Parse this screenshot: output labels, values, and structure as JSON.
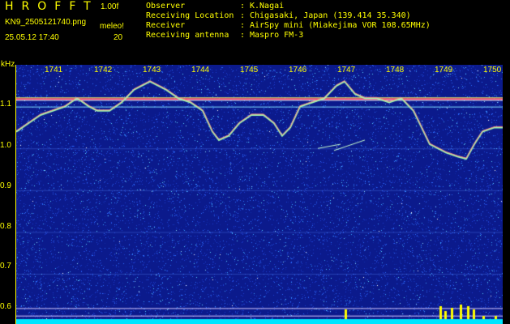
{
  "header": {
    "app_title": "HROFFT",
    "version": "1.00f",
    "filename": "KN9_2505121740.png",
    "timestamp": "25.05.12 17:40",
    "meleo_label": "meleo!",
    "meleo_value": "20"
  },
  "info": [
    {
      "key": "Observer",
      "value": "K.Nagai"
    },
    {
      "key": "Receiving Location",
      "value": "Chigasaki, Japan (139.414 35.340)"
    },
    {
      "key": "Receiver",
      "value": "AirSpy mini (Miakejima VOR 108.65MHz)"
    },
    {
      "key": "Receiving antenna",
      "value": "Maspro FM-3"
    }
  ],
  "spectrogram": {
    "y_unit": "kHz",
    "y_ticks": [
      "1.1",
      "1.0",
      "0.9",
      "0.8",
      "0.7",
      "0.6"
    ],
    "y_range": [
      0.58,
      1.2
    ],
    "x_ticks": [
      "1741",
      "1742",
      "1743",
      "1744",
      "1745",
      "1746",
      "1747",
      "1748",
      "1749",
      "1750"
    ],
    "x_range": [
      1740.5,
      1750.5
    ],
    "colors": {
      "background": "#0b1a8c",
      "axis": "#ffff00",
      "noise_bar": "#00e5ff"
    }
  }
}
